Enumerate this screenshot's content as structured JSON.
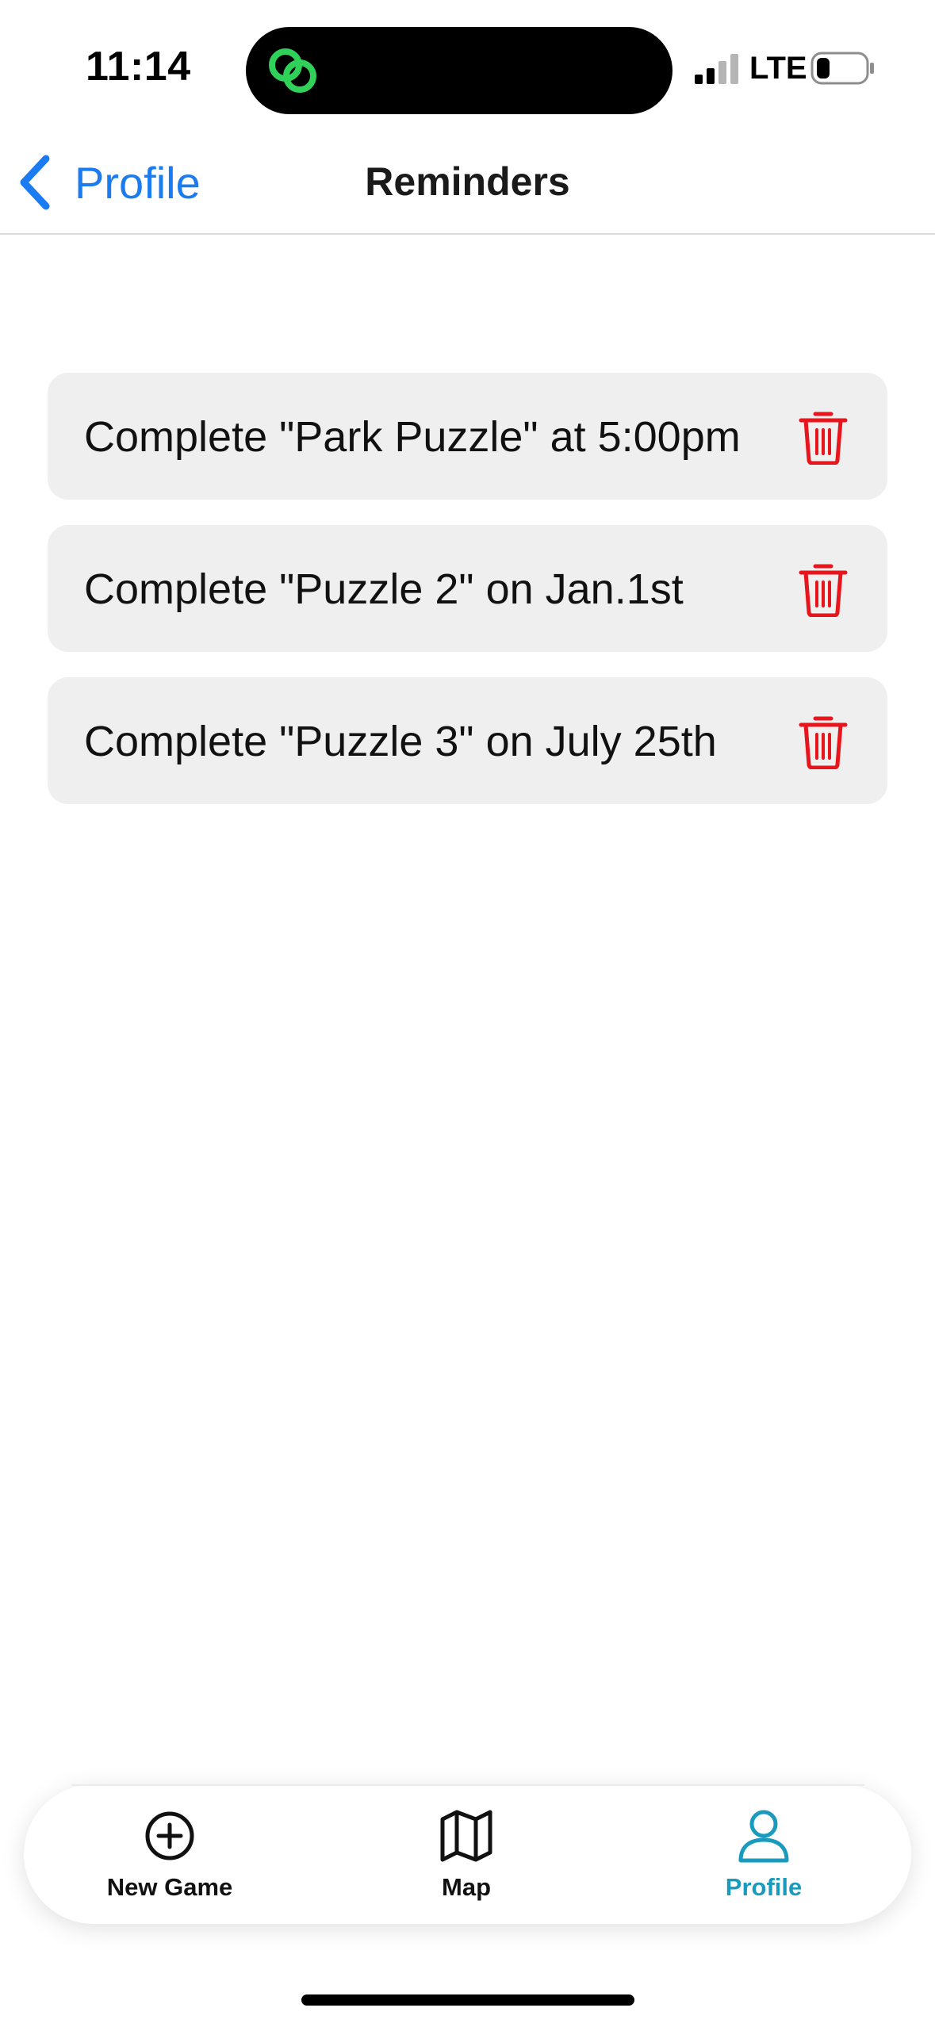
{
  "status_bar": {
    "time": "11:14",
    "network": "LTE",
    "island_icon": "link-rings-icon",
    "signal_icon": "cellular-signal-icon",
    "battery_icon": "battery-low-icon"
  },
  "nav": {
    "back_label": "Profile",
    "title": "Reminders",
    "back_icon": "chevron-left-icon"
  },
  "reminders": [
    {
      "text": "Complete \"Park Puzzle\" at 5:00pm",
      "action_icon": "trash-icon"
    },
    {
      "text": "Complete \"Puzzle 2\" on Jan.1st",
      "action_icon": "trash-icon"
    },
    {
      "text": "Complete \"Puzzle 3\" on July 25th",
      "action_icon": "trash-icon"
    }
  ],
  "tabs": [
    {
      "label": "New Game",
      "icon": "plus-circle-icon",
      "active": false
    },
    {
      "label": "Map",
      "icon": "map-icon",
      "active": false
    },
    {
      "label": "Profile",
      "icon": "person-icon",
      "active": true
    }
  ],
  "colors": {
    "link_blue": "#1a7cf0",
    "active_tab": "#1a9bbd",
    "delete_red": "#e8151c",
    "card_bg": "#efefef",
    "island_accent": "#30d158"
  }
}
